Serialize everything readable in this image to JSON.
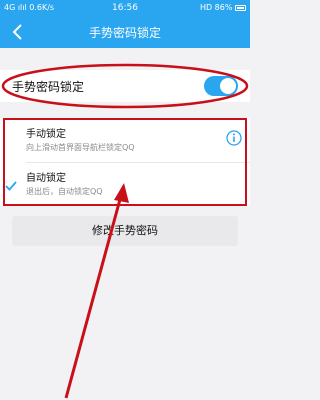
{
  "status_bar": {
    "left": "4G ılıl 0.6K/s",
    "time": "16:56",
    "right": "HD 86%"
  },
  "nav": {
    "title": "手势密码锁定",
    "back_icon": "chevron-left-icon"
  },
  "toggle": {
    "label": "手势密码锁定",
    "enabled": true
  },
  "options": [
    {
      "title": "手动锁定",
      "subtitle": "向上滑动首界面导航栏锁定QQ",
      "selected": false,
      "has_info": true
    },
    {
      "title": "自动锁定",
      "subtitle": "退出后，自动锁定QQ",
      "selected": true,
      "has_info": false
    }
  ],
  "change_button": {
    "label": "修改手势密码"
  },
  "colors": {
    "accent": "#2aa6f0",
    "annotation": "#c8101a",
    "background": "#f2f2f4"
  }
}
